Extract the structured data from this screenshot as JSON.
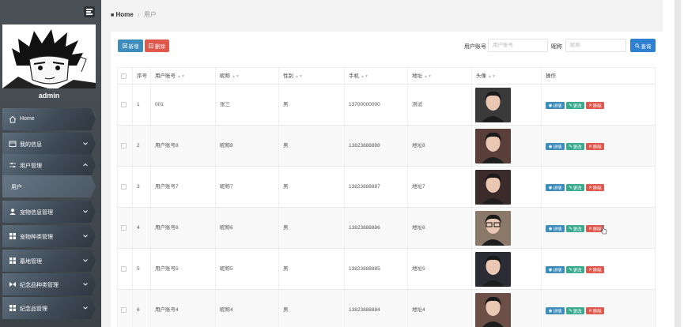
{
  "sidebar": {
    "username": "admin",
    "menu": [
      {
        "label": "Home",
        "icon": "home-icon",
        "chevron": ""
      },
      {
        "label": "我的信息",
        "icon": "card-icon",
        "chevron": "down"
      },
      {
        "label": "用户管理",
        "icon": "sliders-icon",
        "chevron": "up"
      },
      {
        "label": "用户",
        "icon": "",
        "chevron": ""
      },
      {
        "label": "宠物信息管理",
        "icon": "user-icon",
        "chevron": "down"
      },
      {
        "label": "宠物种类管理",
        "icon": "grid-icon",
        "chevron": "down"
      },
      {
        "label": "墓地管理",
        "icon": "grid-icon",
        "chevron": "down"
      },
      {
        "label": "纪念品种类管理",
        "icon": "bowtie-icon",
        "chevron": "down"
      },
      {
        "label": "纪念品管理",
        "icon": "grid-icon",
        "chevron": "down"
      }
    ]
  },
  "breadcrumb": {
    "home": "Home",
    "current": "用户"
  },
  "toolbar": {
    "add_label": "新增",
    "delete_label": "删除",
    "account_label": "用户账号",
    "account_placeholder": "用户账号",
    "nickname_label": "昵称",
    "nickname_placeholder": "昵称",
    "search_label": "查询"
  },
  "table": {
    "headers": [
      "序号",
      "用户账号",
      "昵称",
      "性别",
      "手机",
      "地址",
      "头像",
      "操作"
    ],
    "actions": {
      "detail": "详情",
      "edit": "更改",
      "delete": "移除"
    },
    "rows": [
      {
        "index": "1",
        "account": "001",
        "nickname": "张三",
        "gender": "男",
        "phone": "13700000000",
        "address": "测试"
      },
      {
        "index": "2",
        "account": "用户账号8",
        "nickname": "昵称8",
        "gender": "男",
        "phone": "13823888888",
        "address": "地址8"
      },
      {
        "index": "3",
        "account": "用户账号7",
        "nickname": "昵称7",
        "gender": "男",
        "phone": "13823888887",
        "address": "地址7"
      },
      {
        "index": "4",
        "account": "用户账号6",
        "nickname": "昵称6",
        "gender": "男",
        "phone": "13823888886",
        "address": "地址6"
      },
      {
        "index": "5",
        "account": "用户账号5",
        "nickname": "昵称5",
        "gender": "男",
        "phone": "13823888885",
        "address": "地址5"
      },
      {
        "index": "6",
        "account": "用户账号4",
        "nickname": "昵称4",
        "gender": "男",
        "phone": "13823888884",
        "address": "地址4"
      }
    ]
  },
  "colors": {
    "primary": "#3c8dbc",
    "danger": "#e0574b",
    "success": "#3aab8e",
    "sidebar": "#3b4349"
  }
}
